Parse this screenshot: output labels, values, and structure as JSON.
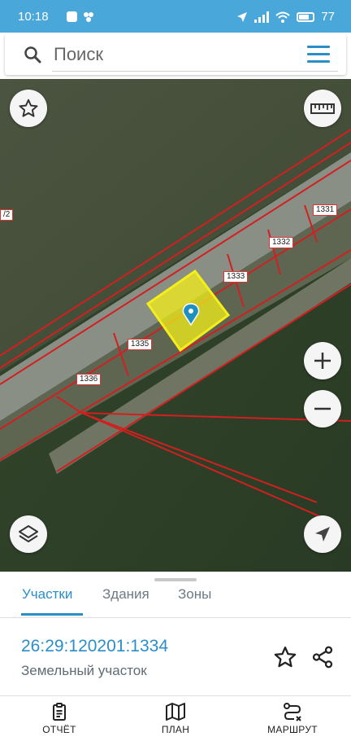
{
  "status_bar": {
    "time": "10:18",
    "battery": "77",
    "battery_level": 0.77,
    "icons": [
      "notification-square-icon",
      "app-dots-icon",
      "location-arrow-icon",
      "signal-icon",
      "wifi-icon",
      "battery-icon"
    ]
  },
  "search": {
    "placeholder": "Поиск",
    "icon": "search-icon",
    "menu_icon": "hamburger-menu-icon"
  },
  "map": {
    "parcel_labels": [
      "1331",
      "1332",
      "1333",
      "1335",
      "1336",
      "/2"
    ],
    "selected_parcel_label": "1334",
    "buttons": [
      "favorite-star-icon",
      "ruler-icon",
      "zoom-in-icon",
      "zoom-out-icon",
      "layers-icon",
      "my-location-icon"
    ],
    "colors": {
      "boundary": "#d21f1f",
      "selected_fill": "#f4ef1a",
      "marker": "#1f8fc0",
      "accent": "#2a8fc8"
    }
  },
  "sheet": {
    "tabs": [
      {
        "label": "Участки",
        "active": true
      },
      {
        "label": "Здания",
        "active": false
      },
      {
        "label": "Зоны",
        "active": false
      }
    ],
    "parcel": {
      "cadastral_number": "26:29:120201:1334",
      "type": "Земельный участок"
    }
  },
  "bottom_nav": {
    "items": [
      {
        "label": "ОТЧЁТ",
        "icon": "report-clipboard-icon"
      },
      {
        "label": "ПЛАН",
        "icon": "map-plan-icon"
      },
      {
        "label": "МАРШРУТ",
        "icon": "route-icon"
      }
    ]
  }
}
